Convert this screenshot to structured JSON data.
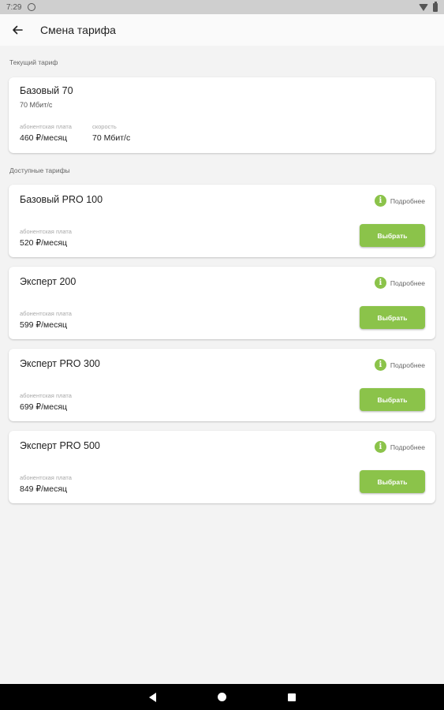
{
  "status_bar": {
    "time": "7:29"
  },
  "header": {
    "title": "Смена тарифа"
  },
  "current": {
    "section_label": "Текущий тариф",
    "name": "Базовый 70",
    "subtitle": "70 Мбит/с",
    "fee_label": "абонентская плата",
    "fee_value": "460 ₽/месяц",
    "speed_label": "скорость",
    "speed_value": "70 Мбит/с"
  },
  "available": {
    "section_label": "Доступные тарифы",
    "details_label": "Подробнее",
    "fee_label": "абонентская плата",
    "choose_label": "Выбрать",
    "tariffs": [
      {
        "name": "Базовый PRO 100",
        "fee": "520 ₽/месяц"
      },
      {
        "name": "Эксперт 200",
        "fee": "599 ₽/месяц"
      },
      {
        "name": "Эксперт PRO 300",
        "fee": "699 ₽/месяц"
      },
      {
        "name": "Эксперт PRO 500",
        "fee": "849 ₽/месяц"
      }
    ]
  },
  "colors": {
    "accent": "#8bc34a",
    "background": "#f3f3f3",
    "card": "#ffffff"
  },
  "icons": {
    "back": "arrow-left-icon",
    "info": "info-icon",
    "nav_back": "nav-back-icon",
    "nav_home": "nav-home-icon",
    "nav_recent": "nav-recent-icon"
  }
}
